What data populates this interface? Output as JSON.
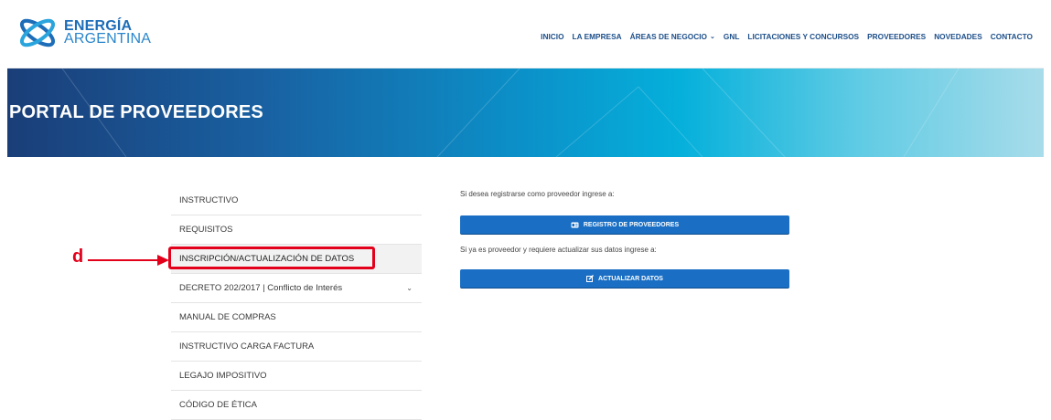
{
  "brand": {
    "line1": "ENERGÍA",
    "line2": "ARGENTINA",
    "logo_icon": "energia-argentina-logo"
  },
  "nav": {
    "items": [
      {
        "label": "INICIO"
      },
      {
        "label": "LA EMPRESA"
      },
      {
        "label": "ÁREAS DE NEGOCIO",
        "chevron": "chevron-down-icon"
      },
      {
        "label": "GNL"
      },
      {
        "label": "LICITACIONES Y CONCURSOS"
      },
      {
        "label": "PROVEEDORES"
      },
      {
        "label": "NOVEDADES"
      },
      {
        "label": "CONTACTO"
      }
    ]
  },
  "banner": {
    "title": "PORTAL DE PROVEEDORES"
  },
  "sidebar": {
    "items": [
      {
        "label": "INSTRUCTIVO"
      },
      {
        "label": "REQUISITOS"
      },
      {
        "label": "INSCRIPCIÓN/ACTUALIZACIÓN DE DATOS",
        "active": true
      },
      {
        "label": "DECRETO 202/2017 | Conflicto de Interés",
        "chevron": "chevron-down-icon"
      },
      {
        "label": "MANUAL DE COMPRAS"
      },
      {
        "label": "INSTRUCTIVO CARGA FACTURA"
      },
      {
        "label": "LEGAJO IMPOSITIVO"
      },
      {
        "label": "CÓDIGO DE ÉTICA"
      }
    ]
  },
  "main": {
    "register_text": "Si desea registrarse como proveedor ingrese a:",
    "register_button": "REGISTRO DE PROVEEDORES",
    "register_icon": "id-card-icon",
    "update_text": "Si ya es proveedor y requiere actualizar sus datos ingrese a:",
    "update_button": "ACTUALIZAR DATOS",
    "update_icon": "edit-icon"
  },
  "annotation": {
    "label": "d",
    "color": "#e3001b"
  },
  "colors": {
    "button": "#1a6fc4",
    "nav_text": "#1d4f8a",
    "brand": "#1d6db8"
  }
}
